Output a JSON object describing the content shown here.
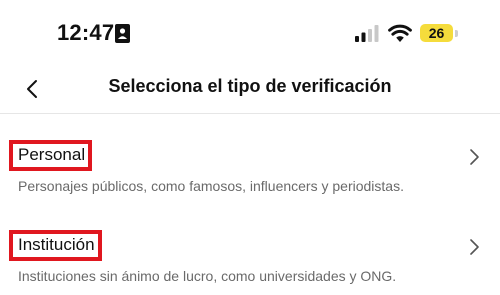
{
  "status_bar": {
    "time": "12:47",
    "battery_level": "26",
    "battery_color": "#f5dc3c",
    "icons": [
      "id-card-icon",
      "cellular-signal-icon",
      "wifi-icon",
      "battery-icon"
    ]
  },
  "header": {
    "title": "Selecciona el tipo de verificación",
    "back_icon": "chevron-left-icon"
  },
  "options": [
    {
      "label": "Personal",
      "description": "Personajes públicos, como famosos, influencers y periodistas.",
      "chevron_icon": "chevron-right-icon"
    },
    {
      "label": "Institución",
      "description": "Instituciones sin ánimo de lucro, como universidades y ONG.",
      "chevron_icon": "chevron-right-icon"
    }
  ],
  "colors": {
    "highlight_border": "#e0171f",
    "description_text": "#6a6a6a",
    "divider": "#e6e6e6"
  }
}
